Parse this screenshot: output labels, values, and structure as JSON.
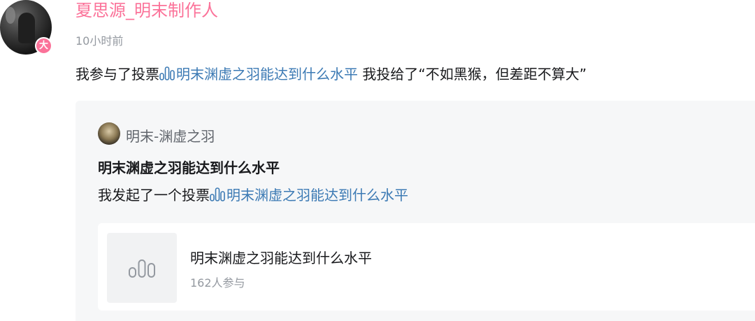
{
  "author": {
    "username": "夏思源_明末制作人",
    "badge": "大",
    "time": "10小时前"
  },
  "post": {
    "prefix": "我参与了投票",
    "vote_link": "明末渊虚之羽能达到什么水平",
    "suffix": " 我投给了“不如黑猴，但差距不算大”"
  },
  "quote": {
    "author": "明末-渊虚之羽",
    "title": "明末渊虚之羽能达到什么水平",
    "body_prefix": "我发起了一个投票",
    "vote_link": "明末渊虚之羽能达到什么水平"
  },
  "vote_card": {
    "title": "明末渊虚之羽能达到什么水平",
    "participants": "162人参与"
  },
  "colors": {
    "username": "#fb7299",
    "link": "#3c7ab4",
    "secondary_text": "#9499a0",
    "quote_background": "#f6f7f8"
  },
  "icons": {
    "vote": "bar-chart-icon",
    "badge": "vip-badge-icon"
  }
}
